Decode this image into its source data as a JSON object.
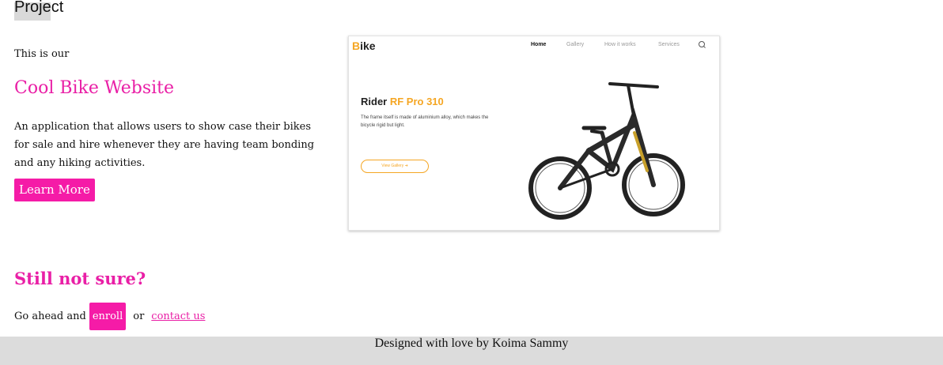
{
  "header": {
    "title": "Project"
  },
  "intro": {
    "text": "This is our"
  },
  "project": {
    "name": "Cool Bike Website",
    "description": "An application that allows users to show case their bikes for sale and hire whenever they are having team bonding and any hiking activities.",
    "learn_more_label": "Learn More"
  },
  "cta": {
    "heading": "Still not sure?",
    "prefix": "Go ahead and",
    "enroll_label": "enroll",
    "or": "or",
    "contact_label": "contact us"
  },
  "footer": {
    "text": "Designed with love by Koima Sammy"
  },
  "preview": {
    "logo_b": "B",
    "logo_rest": "ike",
    "nav": [
      "Home",
      "Gallery",
      "How it works",
      "Services"
    ],
    "heading_main": "Rider ",
    "heading_accent": "RF Pro 310",
    "text": "The frame itself is made of aluminium alloy, which makes the bicycle rigid but light.",
    "button_label": "View Gallery  ➜"
  },
  "colors": {
    "accent": "#e91fa6",
    "button": "#f51ba7",
    "preview_accent": "#f5a623",
    "footer_bg": "#dcdcdc"
  }
}
